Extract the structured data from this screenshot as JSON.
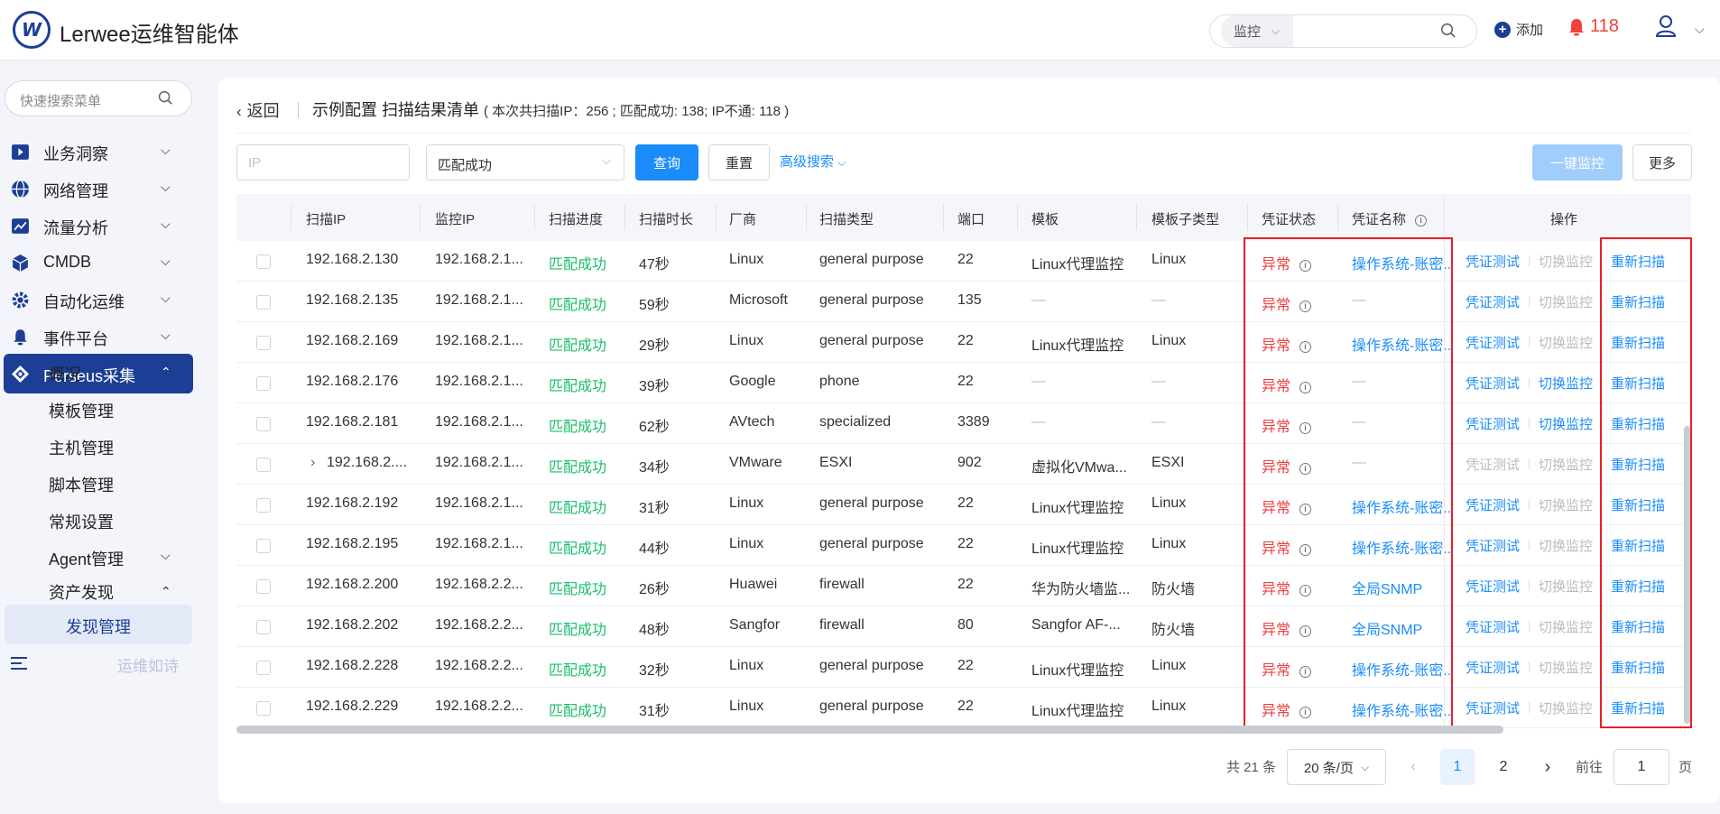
{
  "app": {
    "name": "Lerwee运维智能体",
    "logo_letter": "W"
  },
  "header": {
    "search_scope": "监控",
    "search_placeholder": "",
    "add_label": "添加",
    "alert_count": "118"
  },
  "sidebar": {
    "search_placeholder": "快速搜索菜单",
    "menus": [
      {
        "label": "业务洞察",
        "icon": "business-insight-icon",
        "color": "#1c3f95"
      },
      {
        "label": "网络管理",
        "icon": "globe-icon",
        "color": "#1c3f95"
      },
      {
        "label": "流量分析",
        "icon": "traffic-chart-icon",
        "color": "#1c3f95"
      },
      {
        "label": "CMDB",
        "icon": "cube-icon",
        "color": "#1c3f95"
      },
      {
        "label": "自动化运维",
        "icon": "automation-gear-icon",
        "color": "#1c3f95"
      },
      {
        "label": "事件平台",
        "icon": "bell-icon",
        "color": "#1c3f95"
      },
      {
        "label": "Perseus采集",
        "icon": "perseus-diamond-icon",
        "color": "#ffffff"
      }
    ],
    "submenus": [
      "概况",
      "模板管理",
      "主机管理",
      "脚本管理",
      "常规设置",
      "Agent管理",
      "资产发现"
    ],
    "selected": "发现管理",
    "footer_text": "运维如诗"
  },
  "page": {
    "back_label": "返回",
    "title": "示例配置 扫描结果清单",
    "stats": "( 本次共扫描IP：256 ; 匹配成功: 138; IP不通: 118 )"
  },
  "filters": {
    "ip_placeholder": "IP",
    "status_value": "匹配成功",
    "query_label": "查询",
    "reset_label": "重置",
    "advanced_label": "高级搜索",
    "monitor_all_label": "一键监控",
    "more_label": "更多"
  },
  "table": {
    "headers": [
      "扫描IP",
      "监控IP",
      "扫描进度",
      "扫描时长",
      "厂商",
      "扫描类型",
      "端口",
      "模板",
      "模板子类型",
      "凭证状态",
      "凭证名称",
      "操作"
    ],
    "ops": {
      "test": "凭证测试",
      "switch": "切换监控",
      "rescan": "重新扫描"
    },
    "rows": [
      {
        "scan_ip": "192.168.2.130",
        "monitor_ip": "192.168.2.1...",
        "progress": "匹配成功",
        "duration": "47秒",
        "vendor": "Linux",
        "scan_type": "general purpose",
        "port": "22",
        "template": "Linux代理监控",
        "subtype": "Linux",
        "cred_status": "异常",
        "cred_name": "操作系统-账密...",
        "cred_link": true,
        "test_enabled": true,
        "switch_enabled": false,
        "expand": false
      },
      {
        "scan_ip": "192.168.2.135",
        "monitor_ip": "192.168.2.1...",
        "progress": "匹配成功",
        "duration": "59秒",
        "vendor": "Microsoft",
        "scan_type": "general purpose",
        "port": "135",
        "template": "—",
        "subtype": "—",
        "cred_status": "异常",
        "cred_name": "—",
        "cred_link": false,
        "test_enabled": true,
        "switch_enabled": false,
        "expand": false
      },
      {
        "scan_ip": "192.168.2.169",
        "monitor_ip": "192.168.2.1...",
        "progress": "匹配成功",
        "duration": "29秒",
        "vendor": "Linux",
        "scan_type": "general purpose",
        "port": "22",
        "template": "Linux代理监控",
        "subtype": "Linux",
        "cred_status": "异常",
        "cred_name": "操作系统-账密...",
        "cred_link": true,
        "test_enabled": true,
        "switch_enabled": false,
        "expand": false
      },
      {
        "scan_ip": "192.168.2.176",
        "monitor_ip": "192.168.2.1...",
        "progress": "匹配成功",
        "duration": "39秒",
        "vendor": "Google",
        "scan_type": "phone",
        "port": "22",
        "template": "—",
        "subtype": "—",
        "cred_status": "异常",
        "cred_name": "—",
        "cred_link": false,
        "test_enabled": true,
        "switch_enabled": true,
        "expand": false
      },
      {
        "scan_ip": "192.168.2.181",
        "monitor_ip": "192.168.2.1...",
        "progress": "匹配成功",
        "duration": "62秒",
        "vendor": "AVtech",
        "scan_type": "specialized",
        "port": "3389",
        "template": "—",
        "subtype": "—",
        "cred_status": "异常",
        "cred_name": "—",
        "cred_link": false,
        "test_enabled": true,
        "switch_enabled": true,
        "expand": false
      },
      {
        "scan_ip": "192.168.2....",
        "monitor_ip": "192.168.2.1...",
        "progress": "匹配成功",
        "duration": "34秒",
        "vendor": "VMware",
        "scan_type": "ESXI",
        "port": "902",
        "template": "虚拟化VMwa...",
        "subtype": "ESXI",
        "cred_status": "异常",
        "cred_name": "—",
        "cred_link": false,
        "test_enabled": false,
        "switch_enabled": false,
        "expand": true
      },
      {
        "scan_ip": "192.168.2.192",
        "monitor_ip": "192.168.2.1...",
        "progress": "匹配成功",
        "duration": "31秒",
        "vendor": "Linux",
        "scan_type": "general purpose",
        "port": "22",
        "template": "Linux代理监控",
        "subtype": "Linux",
        "cred_status": "异常",
        "cred_name": "操作系统-账密...",
        "cred_link": true,
        "test_enabled": true,
        "switch_enabled": false,
        "expand": false
      },
      {
        "scan_ip": "192.168.2.195",
        "monitor_ip": "192.168.2.1...",
        "progress": "匹配成功",
        "duration": "44秒",
        "vendor": "Linux",
        "scan_type": "general purpose",
        "port": "22",
        "template": "Linux代理监控",
        "subtype": "Linux",
        "cred_status": "异常",
        "cred_name": "操作系统-账密...",
        "cred_link": true,
        "test_enabled": true,
        "switch_enabled": false,
        "expand": false
      },
      {
        "scan_ip": "192.168.2.200",
        "monitor_ip": "192.168.2.2...",
        "progress": "匹配成功",
        "duration": "26秒",
        "vendor": "Huawei",
        "scan_type": "firewall",
        "port": "22",
        "template": "华为防火墙监...",
        "subtype": "防火墙",
        "cred_status": "异常",
        "cred_name": "全局SNMP",
        "cred_link": true,
        "test_enabled": true,
        "switch_enabled": false,
        "expand": false
      },
      {
        "scan_ip": "192.168.2.202",
        "monitor_ip": "192.168.2.2...",
        "progress": "匹配成功",
        "duration": "48秒",
        "vendor": "Sangfor",
        "scan_type": "firewall",
        "port": "80",
        "template": "Sangfor AF-...",
        "subtype": "防火墙",
        "cred_status": "异常",
        "cred_name": "全局SNMP",
        "cred_link": true,
        "test_enabled": true,
        "switch_enabled": false,
        "expand": false
      },
      {
        "scan_ip": "192.168.2.228",
        "monitor_ip": "192.168.2.2...",
        "progress": "匹配成功",
        "duration": "32秒",
        "vendor": "Linux",
        "scan_type": "general purpose",
        "port": "22",
        "template": "Linux代理监控",
        "subtype": "Linux",
        "cred_status": "异常",
        "cred_name": "操作系统-账密...",
        "cred_link": true,
        "test_enabled": true,
        "switch_enabled": false,
        "expand": false
      },
      {
        "scan_ip": "192.168.2.229",
        "monitor_ip": "192.168.2.2...",
        "progress": "匹配成功",
        "duration": "31秒",
        "vendor": "Linux",
        "scan_type": "general purpose",
        "port": "22",
        "template": "Linux代理监控",
        "subtype": "Linux",
        "cred_status": "异常",
        "cred_name": "操作系统-账密...",
        "cred_link": true,
        "test_enabled": true,
        "switch_enabled": false,
        "expand": false
      }
    ]
  },
  "pagination": {
    "total": "共 21 条",
    "page_size": "20 条/页",
    "pages": [
      "1",
      "2"
    ],
    "current": "1",
    "goto_label": "前往",
    "goto_value": "1",
    "page_suffix": "页"
  },
  "colors": {
    "brand": "#1c3f95",
    "primary": "#1a8cfa",
    "success": "#19be6b",
    "danger": "#ee3f3f",
    "highlight_box": "#e8202a"
  }
}
